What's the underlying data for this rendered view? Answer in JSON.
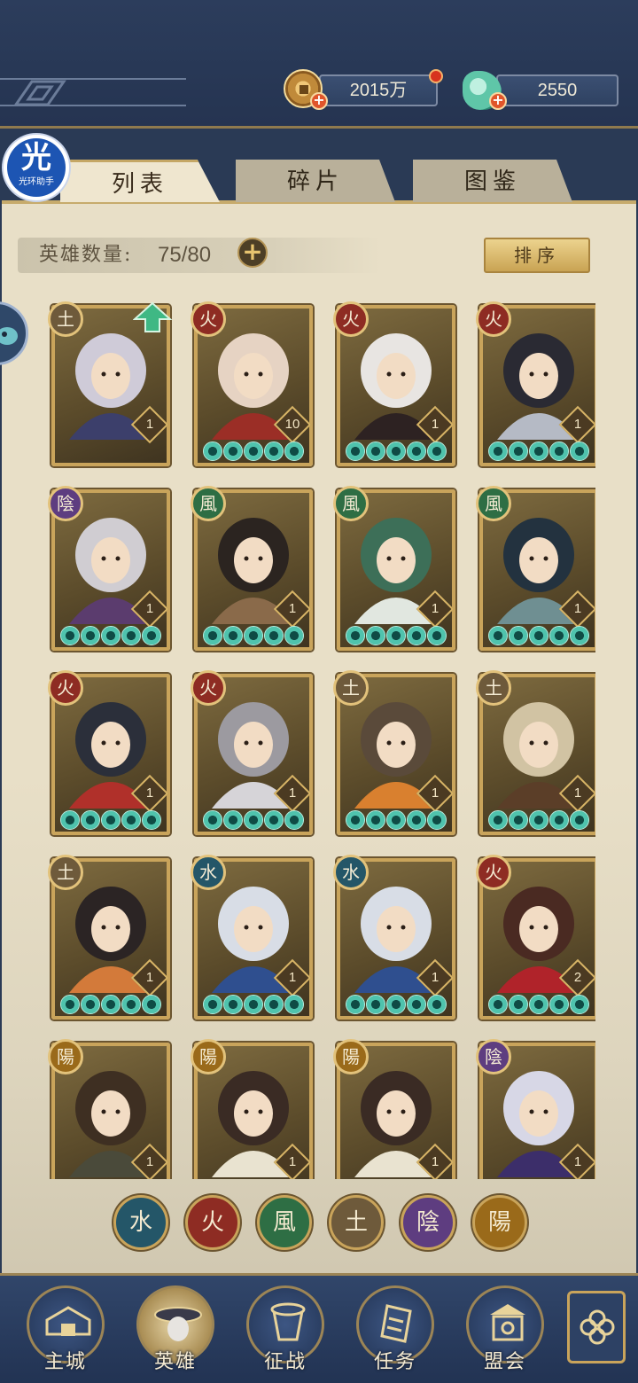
{
  "currency": {
    "coins": "2015万",
    "jade": "2550"
  },
  "helper": {
    "big": "光",
    "small": "光环助手"
  },
  "tabs": [
    {
      "label": "列表",
      "active": true
    },
    {
      "label": "碎片",
      "active": false
    },
    {
      "label": "图鉴",
      "active": false
    }
  ],
  "hero_count": {
    "label": "英雄数量:",
    "value": "75/80"
  },
  "sort_label": "排序",
  "elements": {
    "earth": "土",
    "fire": "火",
    "yin": "陰",
    "wind": "風",
    "water": "水",
    "yang": "陽"
  },
  "heroes": [
    {
      "element": "earth",
      "level": "1",
      "stars": 0,
      "upgrade": true,
      "palette": [
        "#cfcbd8",
        "#3c3f6b"
      ]
    },
    {
      "element": "fire",
      "level": "10",
      "stars": 5,
      "upgrade": false,
      "palette": [
        "#e6d3c3",
        "#9b2e26"
      ]
    },
    {
      "element": "fire",
      "level": "1",
      "stars": 5,
      "upgrade": false,
      "palette": [
        "#e8e5e2",
        "#2d2222"
      ]
    },
    {
      "element": "fire",
      "level": "1",
      "stars": 5,
      "upgrade": false,
      "palette": [
        "#2a2a33",
        "#b5bac5"
      ]
    },
    {
      "element": "yin",
      "level": "1",
      "stars": 5,
      "upgrade": false,
      "palette": [
        "#d0cdd2",
        "#5b3c6e"
      ]
    },
    {
      "element": "wind",
      "level": "1",
      "stars": 5,
      "upgrade": false,
      "palette": [
        "#2b2420",
        "#8a6a4a"
      ]
    },
    {
      "element": "wind",
      "level": "1",
      "stars": 5,
      "upgrade": false,
      "palette": [
        "#3d6f58",
        "#e1e7e0"
      ]
    },
    {
      "element": "wind",
      "level": "1",
      "stars": 5,
      "upgrade": false,
      "palette": [
        "#23323f",
        "#6f8f92"
      ]
    },
    {
      "element": "fire",
      "level": "1",
      "stars": 5,
      "upgrade": false,
      "palette": [
        "#2b2f3a",
        "#b0302a"
      ]
    },
    {
      "element": "fire",
      "level": "1",
      "stars": 5,
      "upgrade": false,
      "palette": [
        "#9c9aa0",
        "#d6d4d8"
      ]
    },
    {
      "element": "earth",
      "level": "1",
      "stars": 5,
      "upgrade": false,
      "palette": [
        "#5a4a3a",
        "#d9802f"
      ]
    },
    {
      "element": "earth",
      "level": "1",
      "stars": 5,
      "upgrade": false,
      "palette": [
        "#d1c3a3",
        "#5b3e28"
      ]
    },
    {
      "element": "earth",
      "level": "1",
      "stars": 5,
      "upgrade": false,
      "palette": [
        "#2b2424",
        "#d37a3a"
      ]
    },
    {
      "element": "water",
      "level": "1",
      "stars": 5,
      "upgrade": false,
      "palette": [
        "#d8dde6",
        "#2f4f8f"
      ]
    },
    {
      "element": "water",
      "level": "1",
      "stars": 5,
      "upgrade": false,
      "palette": [
        "#d8dde6",
        "#2f4f8f"
      ]
    },
    {
      "element": "fire",
      "level": "2",
      "stars": 5,
      "upgrade": false,
      "palette": [
        "#4a2a22",
        "#b0232a"
      ]
    },
    {
      "element": "yang",
      "level": "1",
      "stars": 0,
      "upgrade": false,
      "palette": [
        "#3e2f22",
        "#4a4a3a"
      ]
    },
    {
      "element": "yang",
      "level": "1",
      "stars": 0,
      "upgrade": false,
      "palette": [
        "#3a2b24",
        "#e9e3d0"
      ]
    },
    {
      "element": "yang",
      "level": "1",
      "stars": 0,
      "upgrade": false,
      "palette": [
        "#3a2b24",
        "#e9e3d0"
      ]
    },
    {
      "element": "yin",
      "level": "1",
      "stars": 0,
      "upgrade": false,
      "palette": [
        "#d7d7e6",
        "#3c2e6a"
      ]
    }
  ],
  "filters": [
    "water",
    "fire",
    "wind",
    "earth",
    "yin",
    "yang"
  ],
  "nav": [
    {
      "label": "主城",
      "icon": "city-icon",
      "active": false
    },
    {
      "label": "英雄",
      "icon": "hero-icon",
      "active": true
    },
    {
      "label": "征战",
      "icon": "battle-icon",
      "active": false
    },
    {
      "label": "任务",
      "icon": "task-icon",
      "active": false
    },
    {
      "label": "盟会",
      "icon": "alliance-icon",
      "active": false
    }
  ]
}
